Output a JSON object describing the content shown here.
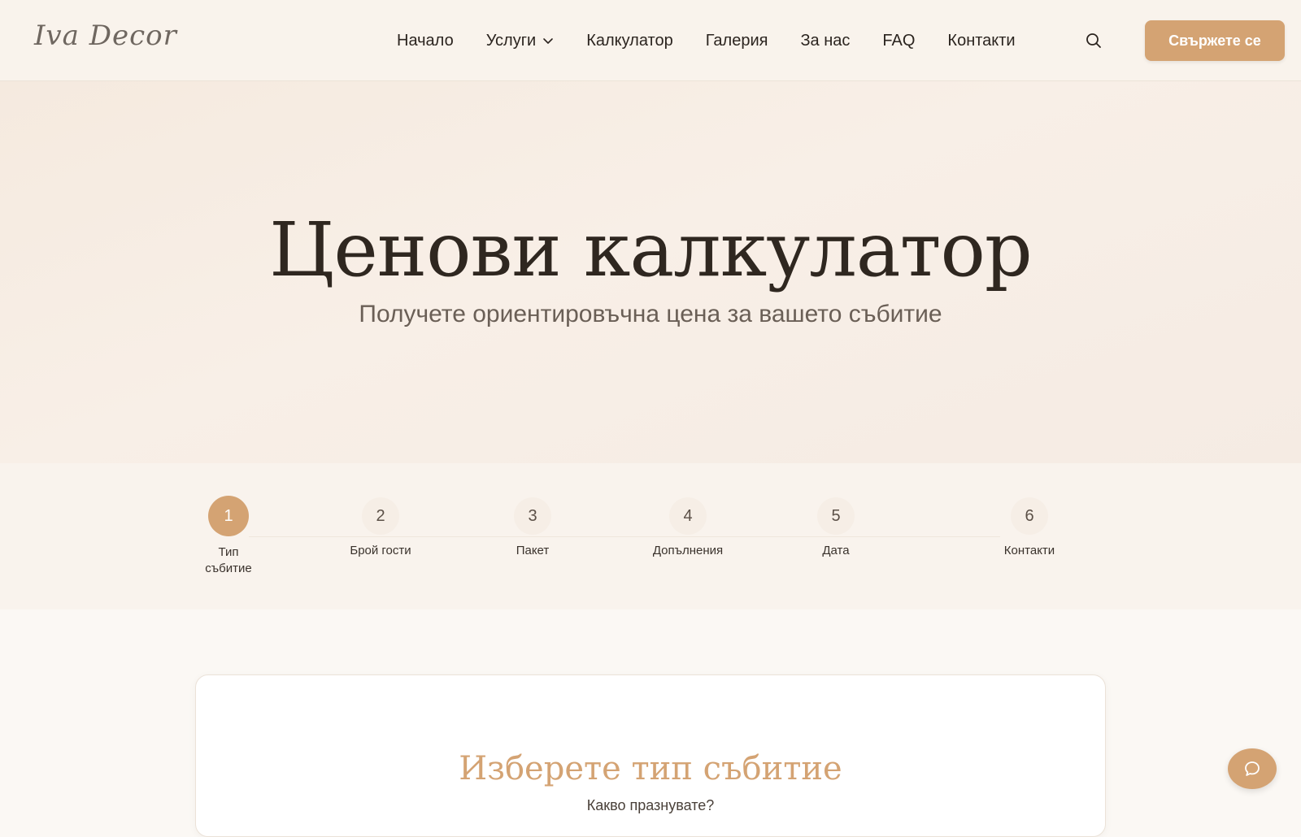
{
  "header": {
    "logo": "Iva Decor",
    "nav": [
      {
        "label": "Начало"
      },
      {
        "label": "Услуги",
        "has_dropdown": true
      },
      {
        "label": "Калкулатор"
      },
      {
        "label": "Галерия"
      },
      {
        "label": "За нас"
      },
      {
        "label": "FAQ"
      },
      {
        "label": "Контакти"
      }
    ],
    "search_icon": "search-icon",
    "cta_label": "Свържете се"
  },
  "hero": {
    "title": "Ценови калкулатор",
    "subtitle": "Получете ориентировъчна цена за вашето събитие"
  },
  "steps": [
    {
      "number": "1",
      "label": "Тип\nсъбитие",
      "active": true
    },
    {
      "number": "2",
      "label": "Брой гости",
      "active": false
    },
    {
      "number": "3",
      "label": "Пакет",
      "active": false
    },
    {
      "number": "4",
      "label": "Допълнения",
      "active": false
    },
    {
      "number": "5",
      "label": "Дата",
      "active": false
    },
    {
      "number": "6",
      "label": "Контакти",
      "active": false
    }
  ],
  "card": {
    "title": "Изберете тип събитие",
    "subtitle": "Какво празнувате?"
  },
  "chat_icon": "chat-icon",
  "colors": {
    "accent": "#d4a373",
    "header_bg": "#f9f3ec",
    "hero_bg": "#f5eadf",
    "text_dark": "#2f2720"
  }
}
